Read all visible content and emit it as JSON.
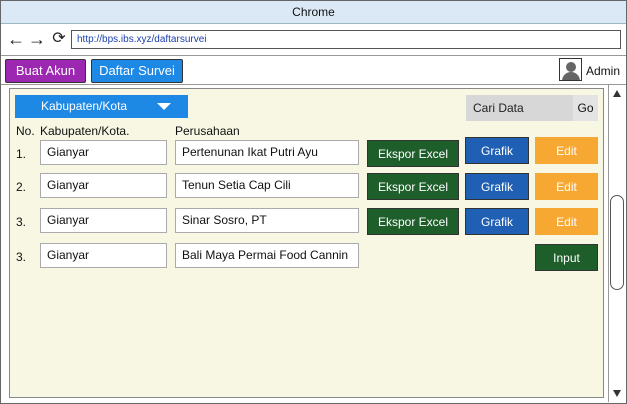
{
  "browser": {
    "title": "Chrome",
    "url": "http://bps.ibs.xyz/daftarsurvei"
  },
  "appbar": {
    "buat_akun": "Buat Akun",
    "daftar_survei": "Daftar Survei",
    "user": "Admin"
  },
  "filters": {
    "region": "Kabupaten/Kota",
    "search_placeholder": "Cari Data",
    "go": "Go"
  },
  "table": {
    "headers": {
      "no": "No.",
      "region": "Kabupaten/Kota.",
      "company": "Perusahaan"
    },
    "rows": [
      {
        "no": "1.",
        "region": "Gianyar",
        "company": "Pertenunan Ikat Putri Ayu",
        "export": "Ekspor Excel",
        "chart": "Grafik",
        "edit": "Edit"
      },
      {
        "no": "2.",
        "region": "Gianyar",
        "company": "Tenun Setia Cap Cili",
        "export": "Ekspor Excel",
        "chart": "Grafik",
        "edit": "Edit"
      },
      {
        "no": "3.",
        "region": "Gianyar",
        "company": "Sinar Sosro, PT",
        "export": "Ekspor Excel",
        "chart": "Grafik",
        "edit": "Edit"
      }
    ],
    "new_row": {
      "no": "3.",
      "region": "Gianyar",
      "company": "Bali Maya Permai Food Cannin",
      "input": "Input"
    }
  },
  "colors": {
    "title_bar": "#dbe9f7",
    "buat_akun": "#9c27b0",
    "daftar_survei": "#1e88e5",
    "excel_button": "#1d5e2a",
    "grafik_button": "#1f5fb4",
    "edit_button": "#f7a833",
    "panel": "#f7f7e3"
  },
  "icons": {
    "back": "arrow-left-icon",
    "forward": "arrow-right-icon",
    "reload": "reload-icon",
    "user": "user-avatar-icon",
    "dropdown": "caret-down-icon"
  }
}
